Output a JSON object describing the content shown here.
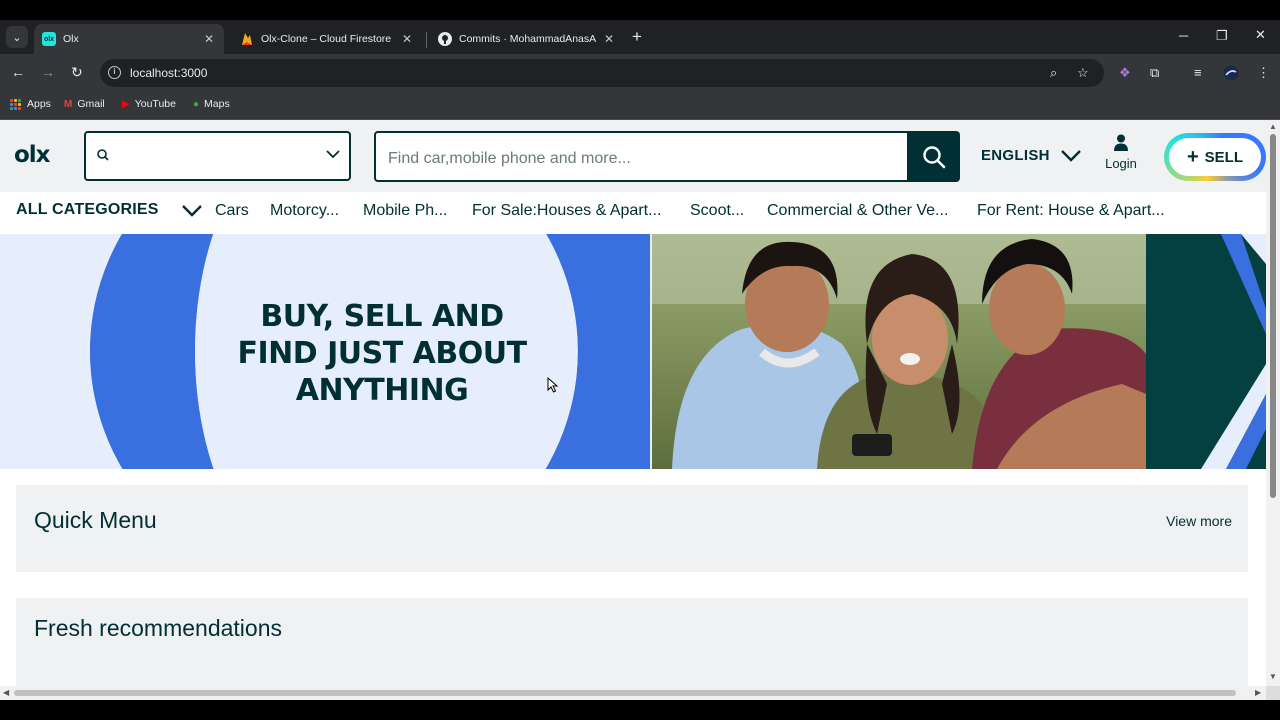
{
  "browser": {
    "tabs": [
      {
        "title": "Olx",
        "active": true
      },
      {
        "title": "Olx-Clone – Cloud Firestore – D",
        "active": false
      },
      {
        "title": "Commits · MohammadAnasAN",
        "active": false
      }
    ],
    "url": "localhost:3000",
    "bookmarks": [
      "Apps",
      "Gmail",
      "YouTube",
      "Maps"
    ]
  },
  "header": {
    "logo": "olx",
    "search_placeholder": "Find car,mobile phone and more...",
    "language": "ENGLISH",
    "login_label": "Login",
    "sell_label": "SELL"
  },
  "categories": {
    "all_label": "ALL CATEGORIES",
    "items": [
      "Cars",
      "Motorcy...",
      "Mobile Ph...",
      "For Sale:Houses & Apart...",
      "Scoot...",
      "Commercial & Other Ve...",
      "For Rent: House & Apart..."
    ]
  },
  "banner": {
    "line1": "BUY, SELL AND",
    "line2": "FIND JUST ABOUT",
    "line3": "ANYTHING"
  },
  "quick_menu": {
    "title": "Quick Menu",
    "view_more": "View more"
  },
  "fresh": {
    "title": "Fresh recommendations"
  },
  "colors": {
    "brand": "#002f34",
    "banner_blue": "#3a6fe0",
    "panel": "#eff1f3"
  }
}
